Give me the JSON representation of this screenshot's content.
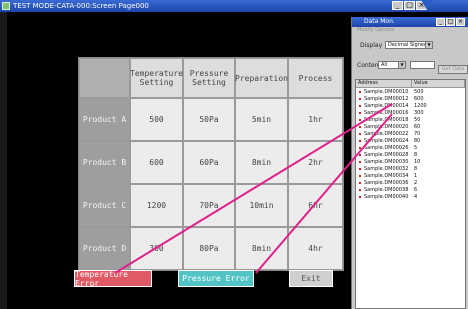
{
  "window": {
    "title": "TEST MODE-CATA-000:Screen Page000"
  },
  "table": {
    "headers": [
      "Temperature\nSetting",
      "Pressure\nSetting",
      "Preparation",
      "Process"
    ],
    "rows": [
      {
        "label": "Product A",
        "temp": "500",
        "press": "50Pa",
        "prep": "5min",
        "proc": "1hr"
      },
      {
        "label": "Product B",
        "temp": "600",
        "press": "60Pa",
        "prep": "8min",
        "proc": "2hr"
      },
      {
        "label": "Product C",
        "temp": "1200",
        "press": "70Pa",
        "prep": "10min",
        "proc": "6hr"
      },
      {
        "label": "Product D",
        "temp": "300",
        "press": "80Pa",
        "prep": "8min",
        "proc": "4hr"
      }
    ]
  },
  "buttons": {
    "temperature_error": "Temperature Error",
    "pressure_error": "Pressure Error",
    "exit": "Exit"
  },
  "monitor": {
    "title": "Data Mon.",
    "menu": "Modify  Options",
    "display_label": "Display",
    "display_value": "Decimal Signed",
    "contents_label": "Contents",
    "contents_value": "All",
    "get_button": "Get Data",
    "col_address": "Address",
    "col_value": "Value",
    "items": [
      {
        "address": "Sample.DM00010",
        "value": "500"
      },
      {
        "address": "Sample.DM00012",
        "value": "600"
      },
      {
        "address": "Sample.DM00014",
        "value": "1200"
      },
      {
        "address": "Sample.DM00016",
        "value": "300"
      },
      {
        "address": "Sample.DM00018",
        "value": "50"
      },
      {
        "address": "Sample.DM00020",
        "value": "60"
      },
      {
        "address": "Sample.DM00022",
        "value": "70"
      },
      {
        "address": "Sample.DM00024",
        "value": "80"
      },
      {
        "address": "Sample.DM00026",
        "value": "5"
      },
      {
        "address": "Sample.DM00028",
        "value": "8"
      },
      {
        "address": "Sample.DM00030",
        "value": "10"
      },
      {
        "address": "Sample.DM00032",
        "value": "8"
      },
      {
        "address": "Sample.DM00034",
        "value": "1"
      },
      {
        "address": "Sample.DM00036",
        "value": "2"
      },
      {
        "address": "Sample.DM00038",
        "value": "6"
      },
      {
        "address": "Sample.DM00040",
        "value": "4"
      }
    ]
  },
  "colors": {
    "connector": "#e0208a",
    "temp_button": "#e05a66",
    "press_button": "#53c4c6"
  }
}
